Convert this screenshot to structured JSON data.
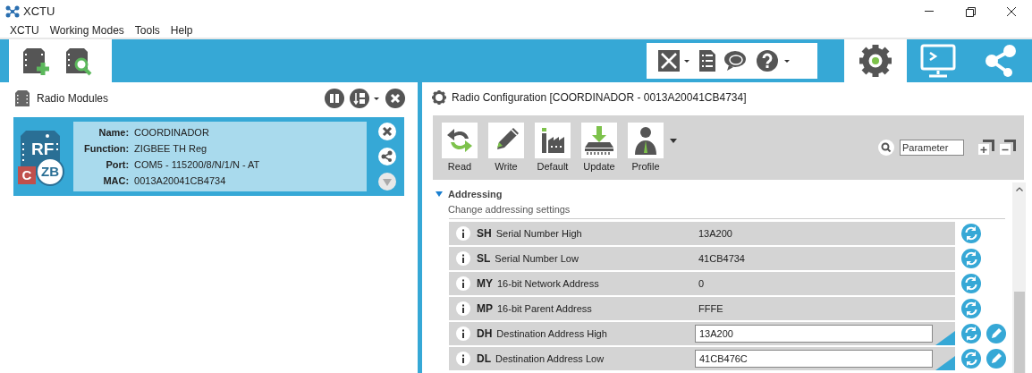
{
  "window": {
    "title": "XCTU"
  },
  "menu": [
    "XCTU",
    "Working Modes",
    "Tools",
    "Help"
  ],
  "mode_tabs": [
    {
      "kind": "configuration",
      "selected": true
    },
    {
      "kind": "console",
      "selected": false
    },
    {
      "kind": "network",
      "selected": false
    }
  ],
  "radio_modules": {
    "title": "Radio Modules",
    "modules": [
      {
        "badge_letter": "C",
        "chip_text": "RF",
        "chip_badge": "ZB",
        "selected": true,
        "fields": [
          {
            "label": "Name:",
            "value": "COORDINADOR"
          },
          {
            "label": "Function:",
            "value": "ZIGBEE TH Reg"
          },
          {
            "label": "Port:",
            "value": "COM5 - 115200/8/N/1/N - AT"
          },
          {
            "label": "MAC:",
            "value": "0013A20041CB4734"
          }
        ]
      }
    ]
  },
  "radio_configuration": {
    "title": "Radio Configuration [COORDINADOR - 0013A20041CB4734]",
    "buttons": [
      {
        "kind": "read",
        "label": "Read"
      },
      {
        "kind": "write",
        "label": "Write"
      },
      {
        "kind": "default",
        "label": "Default"
      },
      {
        "kind": "update",
        "label": "Update"
      },
      {
        "kind": "profile",
        "label": "Profile"
      }
    ],
    "search": {
      "value": "Parameter"
    },
    "section": {
      "title": "Addressing",
      "description": "Change addressing settings",
      "expanded": true,
      "params": [
        {
          "code": "SH",
          "name": "Serial Number High",
          "value": "13A200",
          "kind": "readonly"
        },
        {
          "code": "SL",
          "name": "Serial Number Low",
          "value": "41CB4734",
          "kind": "readonly"
        },
        {
          "code": "MY",
          "name": "16-bit Network Address",
          "value": "0",
          "kind": "readonly"
        },
        {
          "code": "MP",
          "name": "16-bit Parent Address",
          "value": "FFFE",
          "kind": "readonly"
        },
        {
          "code": "DH",
          "name": "Destination Address High",
          "value": "13A200",
          "kind": "editable"
        },
        {
          "code": "DL",
          "name": "Destination Address Low",
          "value": "41CB476C",
          "kind": "editable"
        }
      ]
    }
  }
}
